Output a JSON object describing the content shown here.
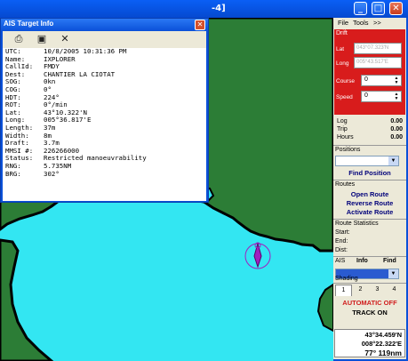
{
  "main_window": {
    "title_fragment": "-4]"
  },
  "ais_window": {
    "title": "AIS Target Info",
    "toolbar": {
      "print_icon": "printer-icon",
      "save_icon": "floppy-disk-icon",
      "close_icon": "x-icon"
    },
    "fields": [
      {
        "label": "UTC:",
        "value": "10/8/2005 10:31:36 PM"
      },
      {
        "label": "Name:",
        "value": "IXPLORER"
      },
      {
        "label": "CallId:",
        "value": "FMDY"
      },
      {
        "label": "Dest:",
        "value": "CHANTIER LA CIOTAT"
      },
      {
        "label": "SOG:",
        "value": "0kn"
      },
      {
        "label": "COG:",
        "value": "0°"
      },
      {
        "label": "HDT:",
        "value": "224°"
      },
      {
        "label": "ROT:",
        "value": "0°/min"
      },
      {
        "label": "Lat:",
        "value": "43°10.322'N"
      },
      {
        "label": "Long:",
        "value": "005°36.817'E"
      },
      {
        "label": "Length:",
        "value": "37m"
      },
      {
        "label": "Width:",
        "value": "8m"
      },
      {
        "label": "Draft:",
        "value": "3.7m"
      },
      {
        "label": "MMSI #:",
        "value": "226266000"
      },
      {
        "label": "Status:",
        "value": "Restricted manoeuvrability"
      },
      {
        "label": "RNG:",
        "value": "5.735NM"
      },
      {
        "label": "BRG:",
        "value": "302°"
      }
    ]
  },
  "panel": {
    "menu": {
      "file": "File",
      "tools": "Tools",
      "more": ">>"
    },
    "drift": {
      "title": "Drift",
      "lat_label": "Lat",
      "lat_value": "043°07.323'N",
      "long_label": "Long",
      "long_value": "005°43.517'E",
      "course_label": "Course",
      "course_value": "0",
      "speed_label": "Speed",
      "speed_value": "0"
    },
    "stats": [
      {
        "label": "Log",
        "value": "0.00"
      },
      {
        "label": "Trip",
        "value": "0.00"
      },
      {
        "label": "Hours",
        "value": "0.00"
      }
    ],
    "positions_label": "Positions",
    "find_position": "Find Position",
    "routes_label": "Routes",
    "open_route": "Open Route",
    "reverse_route": "Reverse Route",
    "activate_route": "Activate Route",
    "route_stats_label": "Route Statistics",
    "start_label": "Start:",
    "end_label": "End:",
    "dist_label": "Dist:",
    "ais_label": "AIS",
    "ais_info": "Info",
    "ais_find": "Find",
    "shading_label": "Shading",
    "shading_tabs": [
      "1",
      "2",
      "3",
      "4"
    ],
    "automatic_off": "AUTOMATIC OFF",
    "track_on": "TRACK ON",
    "coord_lat": "43°34.459'N",
    "coord_long": "008°22.322'E",
    "coord_brg_rng": "77°  119nm"
  },
  "colors": {
    "sea": "#33e6f2",
    "land": "#2c7d36",
    "coast": "#000000",
    "drift_box": "#d81c1c",
    "target": "#a020c0"
  }
}
